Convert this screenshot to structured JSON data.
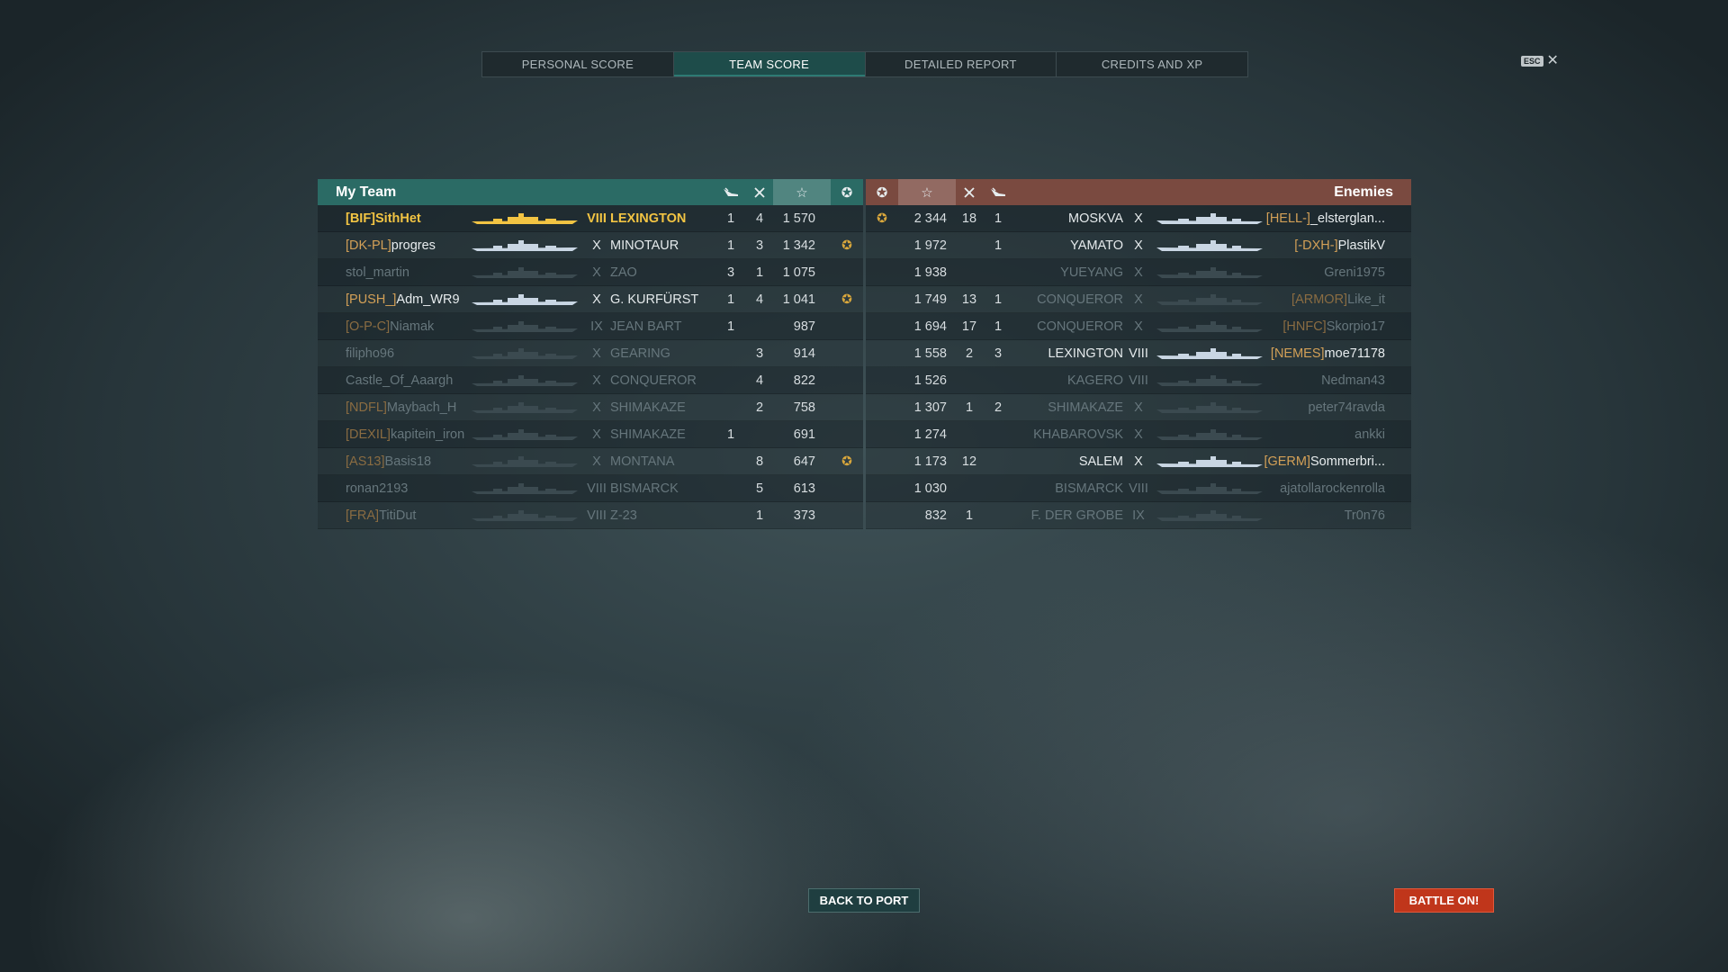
{
  "tabs": [
    "PERSONAL SCORE",
    "TEAM SCORE",
    "DETAILED REPORT",
    "CREDITS AND XP"
  ],
  "active_tab": "TEAM SCORE",
  "esc_label": "ESC",
  "close_glyph": "✕",
  "my_team": {
    "title": "My Team",
    "header_icons": [
      "plane-kill-icon",
      "ship-kill-icon",
      "star-icon",
      "medal-icon"
    ],
    "rows": [
      {
        "tag": "[BIF]",
        "name": "SithHet",
        "tier": "VIII",
        "ship": "LEXINGTON",
        "planes": "1",
        "ships": "4",
        "score": "1 570",
        "medal": "",
        "state": "me"
      },
      {
        "tag": "[DK-PL]",
        "name": "progres",
        "tier": "X",
        "ship": "MINOTAUR",
        "planes": "1",
        "ships": "3",
        "score": "1 342",
        "medal": "✪",
        "state": "alive"
      },
      {
        "tag": "",
        "name": "stol_martin",
        "tier": "X",
        "ship": "ZAO",
        "planes": "3",
        "ships": "1",
        "score": "1 075",
        "medal": "",
        "state": "dead"
      },
      {
        "tag": "[PUSH_]",
        "name": "Adm_WR9",
        "tier": "X",
        "ship": "G. KURFÜRST",
        "planes": "1",
        "ships": "4",
        "score": "1 041",
        "medal": "✪",
        "state": "alive"
      },
      {
        "tag": "[O-P-C]",
        "name": "Niamak",
        "tier": "IX",
        "ship": "JEAN BART",
        "planes": "1",
        "ships": "",
        "score": "987",
        "medal": "",
        "state": "dead"
      },
      {
        "tag": "",
        "name": "filipho96",
        "tier": "X",
        "ship": "GEARING",
        "planes": "",
        "ships": "3",
        "score": "914",
        "medal": "",
        "state": "dead"
      },
      {
        "tag": "",
        "name": "Castle_Of_Aaargh",
        "tier": "X",
        "ship": "CONQUEROR",
        "planes": "",
        "ships": "4",
        "score": "822",
        "medal": "",
        "state": "dead"
      },
      {
        "tag": "[NDFL]",
        "name": "Maybach_H",
        "tier": "X",
        "ship": "SHIMAKAZE",
        "planes": "",
        "ships": "2",
        "score": "758",
        "medal": "",
        "state": "dead"
      },
      {
        "tag": "[DEXIL]",
        "name": "kapitein_iron",
        "tier": "X",
        "ship": "SHIMAKAZE",
        "planes": "1",
        "ships": "",
        "score": "691",
        "medal": "",
        "state": "dead"
      },
      {
        "tag": "[AS13]",
        "name": "Basis18",
        "tier": "X",
        "ship": "MONTANA",
        "planes": "",
        "ships": "8",
        "score": "647",
        "medal": "✪",
        "state": "dead"
      },
      {
        "tag": "",
        "name": "ronan2193",
        "tier": "VIII",
        "ship": "BISMARCK",
        "planes": "",
        "ships": "5",
        "score": "613",
        "medal": "",
        "state": "dead"
      },
      {
        "tag": "[FRA]",
        "name": "TitiDut",
        "tier": "VIII",
        "ship": "Z-23",
        "planes": "",
        "ships": "1",
        "score": "373",
        "medal": "",
        "state": "dead"
      }
    ]
  },
  "enemies": {
    "title": "Enemies",
    "rows": [
      {
        "tag": "[HELL-]",
        "name": "_elsterglan...",
        "tier": "X",
        "ship": "MOSKVA",
        "planes": "1",
        "ships": "18",
        "score": "2 344",
        "medal": "✪",
        "state": "alive"
      },
      {
        "tag": "[-DXH-]",
        "name": "PlastikV",
        "tier": "X",
        "ship": "YAMATO",
        "planes": "1",
        "ships": "",
        "score": "1 972",
        "medal": "",
        "state": "alive"
      },
      {
        "tag": "",
        "name": "Greni1975",
        "tier": "X",
        "ship": "YUEYANG",
        "planes": "",
        "ships": "",
        "score": "1 938",
        "medal": "",
        "state": "dead"
      },
      {
        "tag": "[ARMOR]",
        "name": "Like_it",
        "tier": "X",
        "ship": "CONQUEROR",
        "planes": "1",
        "ships": "13",
        "score": "1 749",
        "medal": "",
        "state": "dead"
      },
      {
        "tag": "[HNFC]",
        "name": "Skorpio17",
        "tier": "X",
        "ship": "CONQUEROR",
        "planes": "1",
        "ships": "17",
        "score": "1 694",
        "medal": "",
        "state": "dead"
      },
      {
        "tag": "[NEMES]",
        "name": "moe71178",
        "tier": "VIII",
        "ship": "LEXINGTON",
        "planes": "3",
        "ships": "2",
        "score": "1 558",
        "medal": "",
        "state": "alive"
      },
      {
        "tag": "",
        "name": "Nedman43",
        "tier": "VIII",
        "ship": "KAGERO",
        "planes": "",
        "ships": "",
        "score": "1 526",
        "medal": "",
        "state": "dead"
      },
      {
        "tag": "",
        "name": "peter74ravda",
        "tier": "X",
        "ship": "SHIMAKAZE",
        "planes": "2",
        "ships": "1",
        "score": "1 307",
        "medal": "",
        "state": "dead"
      },
      {
        "tag": "",
        "name": "ankki",
        "tier": "X",
        "ship": "KHABAROVSK",
        "planes": "",
        "ships": "",
        "score": "1 274",
        "medal": "",
        "state": "dead"
      },
      {
        "tag": "[GERM]",
        "name": "Sommerbri...",
        "tier": "X",
        "ship": "SALEM",
        "planes": "",
        "ships": "12",
        "score": "1 173",
        "medal": "",
        "state": "alive"
      },
      {
        "tag": "",
        "name": "ajatollarockenrolla",
        "tier": "VIII",
        "ship": "BISMARCK",
        "planes": "",
        "ships": "",
        "score": "1 030",
        "medal": "",
        "state": "dead"
      },
      {
        "tag": "",
        "name": "Tr0n76",
        "tier": "IX",
        "ship": "F. DER GROBE",
        "planes": "",
        "ships": "1",
        "score": "832",
        "medal": "",
        "state": "dead"
      }
    ]
  },
  "buttons": {
    "back": "BACK TO PORT",
    "battle": "BATTLE ON!"
  },
  "colors": {
    "my_team_header": "#2b6b65",
    "enemy_header": "#7a4a40",
    "active_tab": "#1e4c4a",
    "highlight": "#f2c443",
    "battle_button": "#c0361b"
  }
}
